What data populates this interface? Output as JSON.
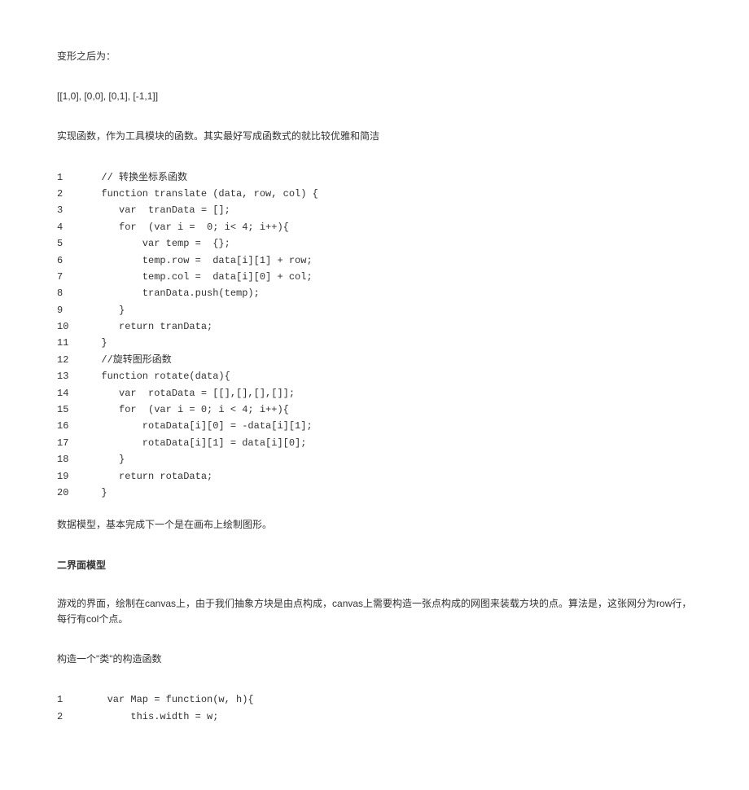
{
  "paragraphs": {
    "p1": "变形之后为：",
    "p2": "[[1,0], [0,0], [0,1], [-1,1]]",
    "p3": "实现函数，作为工具模块的函数。其实最好写成函数式的就比较优雅和简洁",
    "p4": "数据模型，基本完成下一个是在画布上绘制图形。",
    "p5": "游戏的界面，绘制在canvas上，由于我们抽象方块是由点构成，canvas上需要构造一张点构成的网图来装载方块的点。算法是，这张网分为row行，每行有col个点。",
    "p6": "构造一个\"类\"的构造函数"
  },
  "sectionTitle": "二界面模型",
  "code1": [
    {
      "n": "1",
      "c": "  // 转换坐标系函数"
    },
    {
      "n": "2",
      "c": "  function translate (data, row, col) {"
    },
    {
      "n": "3",
      "c": "     var  tranData = [];"
    },
    {
      "n": "4",
      "c": "     for  (var i =  0; i< 4; i++){"
    },
    {
      "n": "5",
      "c": "         var temp =  {};"
    },
    {
      "n": "6",
      "c": "         temp.row =  data[i][1] + row;"
    },
    {
      "n": "7",
      "c": "         temp.col =  data[i][0] + col;"
    },
    {
      "n": "8",
      "c": "         tranData.push(temp);"
    },
    {
      "n": "9",
      "c": "     }"
    },
    {
      "n": "10",
      "c": "     return tranData;"
    },
    {
      "n": "11",
      "c": "  }"
    },
    {
      "n": "12",
      "c": "  //旋转图形函数"
    },
    {
      "n": "13",
      "c": "  function rotate(data){"
    },
    {
      "n": "14",
      "c": "     var  rotaData = [[],[],[],[]];"
    },
    {
      "n": "15",
      "c": "     for  (var i = 0; i < 4; i++){"
    },
    {
      "n": "16",
      "c": "         rotaData[i][0] = -data[i][1];"
    },
    {
      "n": "17",
      "c": "         rotaData[i][1] = data[i][0];"
    },
    {
      "n": "18",
      "c": "     }"
    },
    {
      "n": "19",
      "c": "     return rotaData;"
    },
    {
      "n": "20",
      "c": "  }"
    }
  ],
  "code2": [
    {
      "n": "1",
      "c": "   var Map = function(w, h){"
    },
    {
      "n": "2",
      "c": "       this.width = w;"
    }
  ]
}
